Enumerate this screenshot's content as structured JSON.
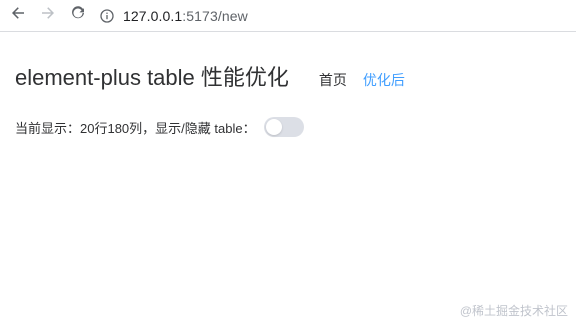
{
  "browser": {
    "url_host": "127.0.0.1",
    "url_port_path": ":5173/new",
    "icons": {
      "back": "back-arrow-icon",
      "forward": "forward-arrow-icon",
      "reload": "reload-icon",
      "info": "info-icon"
    }
  },
  "page": {
    "title": "element-plus table 性能优化",
    "nav": {
      "home": "首页",
      "optimized": "优化后"
    },
    "status_label": "当前显示：20行180列，",
    "toggle_label": "显示/隐藏 table：",
    "toggle_on": false
  },
  "watermark": "@稀土掘金技术社区",
  "colors": {
    "accent": "#409eff",
    "text": "#303133",
    "switch_off": "#dcdfe6"
  }
}
